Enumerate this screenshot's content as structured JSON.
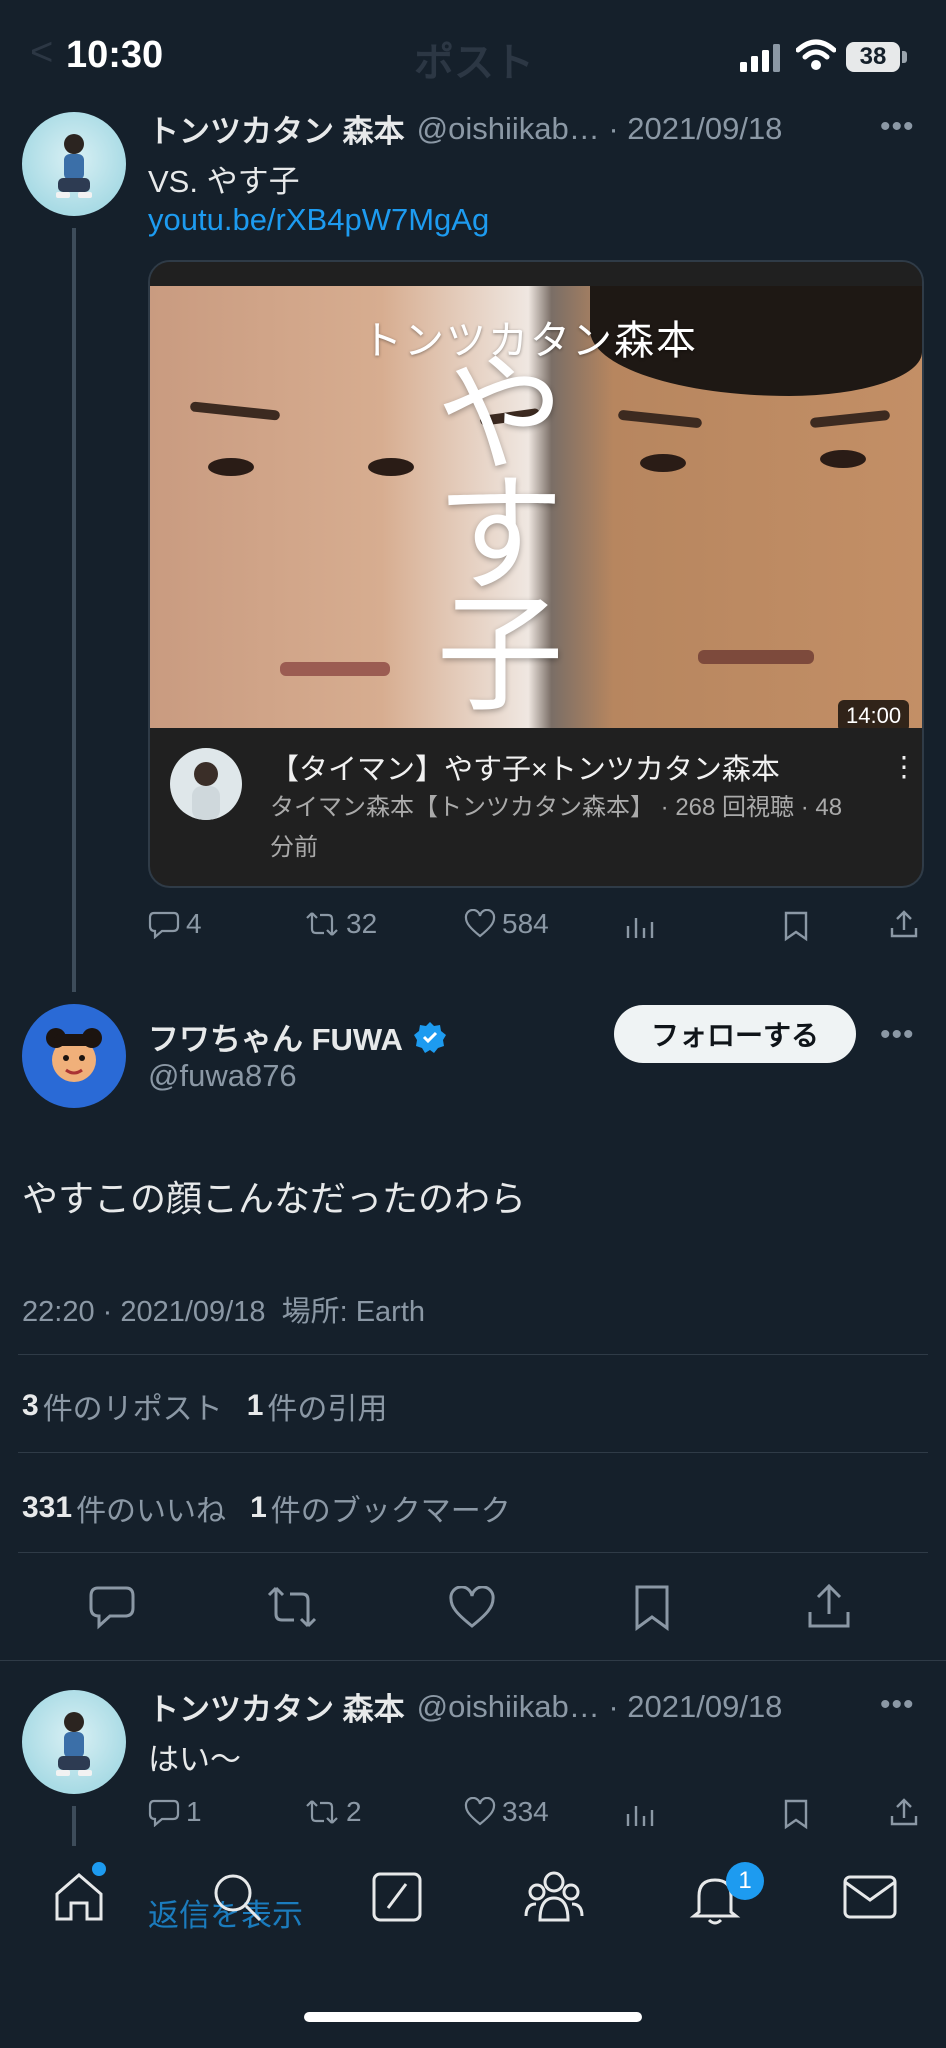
{
  "status_bar": {
    "time": "10:30",
    "battery": "38",
    "title_ghost": "ポスト"
  },
  "post1": {
    "name": "トンツカタン 森本",
    "handle_date": "@oishiikab… · 2021/09/18",
    "text": "VS. やす子",
    "link": "youtu.be/rXB4pW7MgAg",
    "card": {
      "thumb_title": "トンツカタン森本",
      "thumb_big": "やす子",
      "duration": "14:00",
      "video_title": "【タイマン】やす子×トンツカタン森本",
      "video_sub": "タイマン森本【トンツカタン森本】 · 268 回視聴 · 48 分前"
    },
    "actions": {
      "replies": "4",
      "reposts": "32",
      "likes": "584"
    }
  },
  "main_post": {
    "name": "フワちゃん FUWA",
    "handle": "@fuwa876",
    "follow_label": "フォローする",
    "text": "やすこの顔こんなだったのわら",
    "meta": "22:20 · 2021/09/18  場所: Earth",
    "stats1": {
      "reposts_count": "3",
      "reposts_label": "件のリポスト",
      "quotes_count": "1",
      "quotes_label": "件の引用"
    },
    "stats2": {
      "likes_count": "331",
      "likes_label": "件のいいね",
      "bookmarks_count": "1",
      "bookmarks_label": "件のブックマーク"
    }
  },
  "reply": {
    "name": "トンツカタン 森本",
    "handle_date": "@oishiikab… · 2021/09/18",
    "text": "はい〜",
    "actions": {
      "replies": "1",
      "reposts": "2",
      "likes": "334"
    },
    "show_replies": "返信を表示"
  },
  "tabbar": {
    "notifications_badge": "1"
  },
  "colors": {
    "background": "#15202b",
    "accent": "#1d9bf0",
    "text": "#e7e9ea",
    "muted": "#8b98a5"
  }
}
